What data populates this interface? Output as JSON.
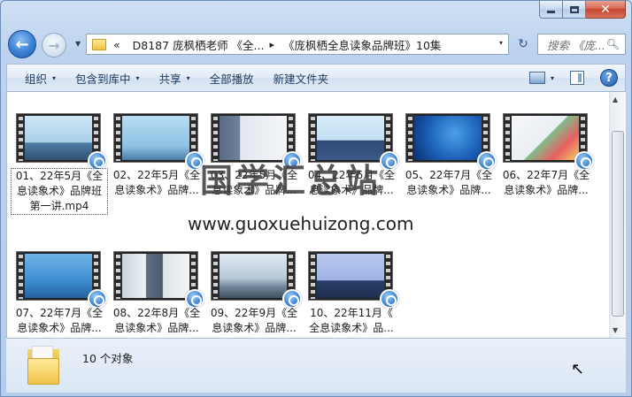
{
  "window": {
    "caption": {
      "minimize": "minimize",
      "maximize": "maximize",
      "close": "✕"
    }
  },
  "nav": {
    "back_icon": "back-arrow-icon",
    "forward_icon": "forward-arrow-icon",
    "history_icon": "chevron-down-icon",
    "address": {
      "overflow": "«",
      "crumb1": "D8187 庞枫栖老师 《全...",
      "separator": "▸",
      "crumb2": "《庞枫栖全息读象品牌班》10集",
      "dropdown": "▾"
    },
    "refresh": "↻",
    "search_placeholder": "搜索 《庞..."
  },
  "toolbar": {
    "organize": "组织",
    "include_library": "包含到库中",
    "share": "共享",
    "play_all": "全部播放",
    "new_folder": "新建文件夹",
    "dropdown": "▾",
    "help": "?"
  },
  "files": [
    {
      "line1": "01、22年5月《全",
      "line2": "息读象术》品牌班",
      "line3": "第一讲.mp4",
      "selected": true
    },
    {
      "line1": "02、22年5月《全",
      "line2": "息读象术》品牌..."
    },
    {
      "line1": "03、22年5月《全",
      "line2": "息读象术》品牌..."
    },
    {
      "line1": "04、22年6月《全",
      "line2": "息读象术》品牌..."
    },
    {
      "line1": "05、22年7月《全",
      "line2": "息读象术》品牌..."
    },
    {
      "line1": "06、22年7月《全",
      "line2": "息读象术》品牌..."
    },
    {
      "line1": "07、22年7月《全",
      "line2": "息读象术》品牌..."
    },
    {
      "line1": "08、22年8月《全",
      "line2": "息读象术》品牌..."
    },
    {
      "line1": "09、22年9月《全",
      "line2": "息读象术》品牌..."
    },
    {
      "line1": "10、22年11月《",
      "line2": "全息读象术》品..."
    }
  ],
  "watermark": {
    "title": "国学汇总站",
    "url": "www.guoxuehuizong.com"
  },
  "details": {
    "count": "10 个对象"
  },
  "scroll": {
    "up": "▲",
    "down": "▼"
  },
  "colors": {
    "window_frame": "#b5cdea",
    "close_button": "#c5452c",
    "content_bg": "#ffffff",
    "details_bg": "#dbe7f5"
  }
}
